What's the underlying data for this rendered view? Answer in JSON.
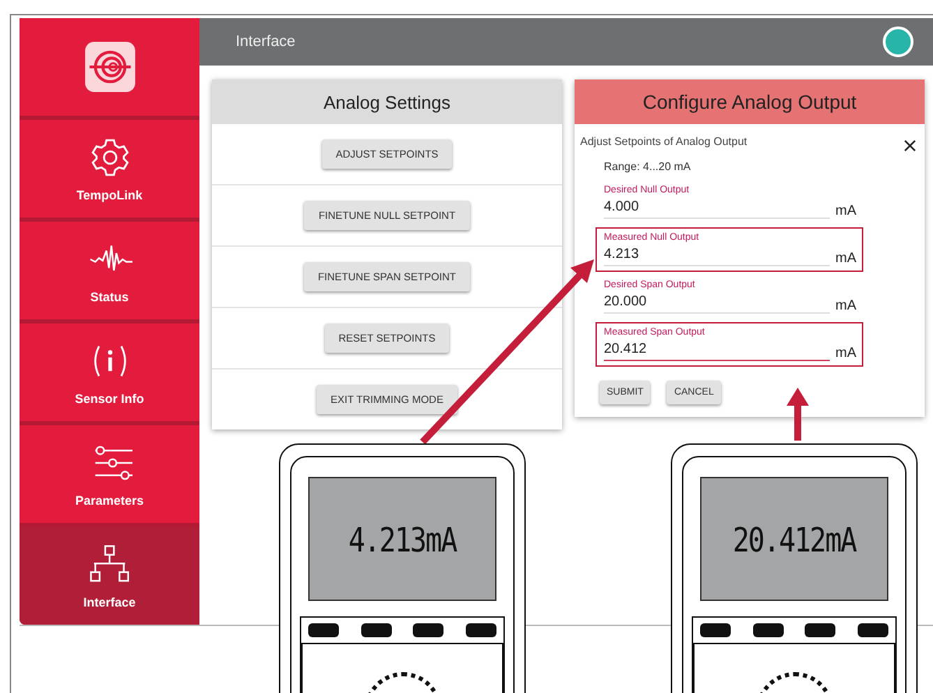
{
  "window": {
    "title": "Interface"
  },
  "sidebar": {
    "items": [
      {
        "kind": "logo",
        "selected": false
      },
      {
        "kind": "gear",
        "label": "TempoLink",
        "selected": false
      },
      {
        "kind": "wave",
        "label": "Status",
        "selected": false
      },
      {
        "kind": "info",
        "label": "Sensor Info",
        "selected": false
      },
      {
        "kind": "sliders",
        "label": "Parameters",
        "selected": false
      },
      {
        "kind": "network",
        "label": "Interface",
        "selected": true
      }
    ]
  },
  "analog_settings": {
    "title": "Analog Settings",
    "buttons": [
      "ADJUST SETPOINTS",
      "FINETUNE NULL SETPOINT",
      "FINETUNE SPAN SETPOINT",
      "RESET SETPOINTS",
      "EXIT TRIMMING MODE"
    ]
  },
  "configure_dialog": {
    "title": "Configure Analog Output",
    "subtitle": "Adjust Setpoints of Analog Output",
    "range": "Range: 4...20 mA",
    "fields": [
      {
        "label": "Desired Null Output",
        "value": "4.000",
        "unit": "mA",
        "highlighted": false,
        "focused": false
      },
      {
        "label": "Measured Null Output",
        "value": "4.213",
        "unit": "mA",
        "highlighted": true,
        "focused": false
      },
      {
        "label": "Desired Span Output",
        "value": "20.000",
        "unit": "mA",
        "highlighted": false,
        "focused": false
      },
      {
        "label": "Measured Span Output",
        "value": "20.412",
        "unit": "mA",
        "highlighted": true,
        "focused": true
      }
    ],
    "buttons": [
      "SUBMIT",
      "CANCEL"
    ]
  },
  "multimeters": [
    {
      "reading": "4.213mA"
    },
    {
      "reading": "20.412mA"
    }
  ]
}
